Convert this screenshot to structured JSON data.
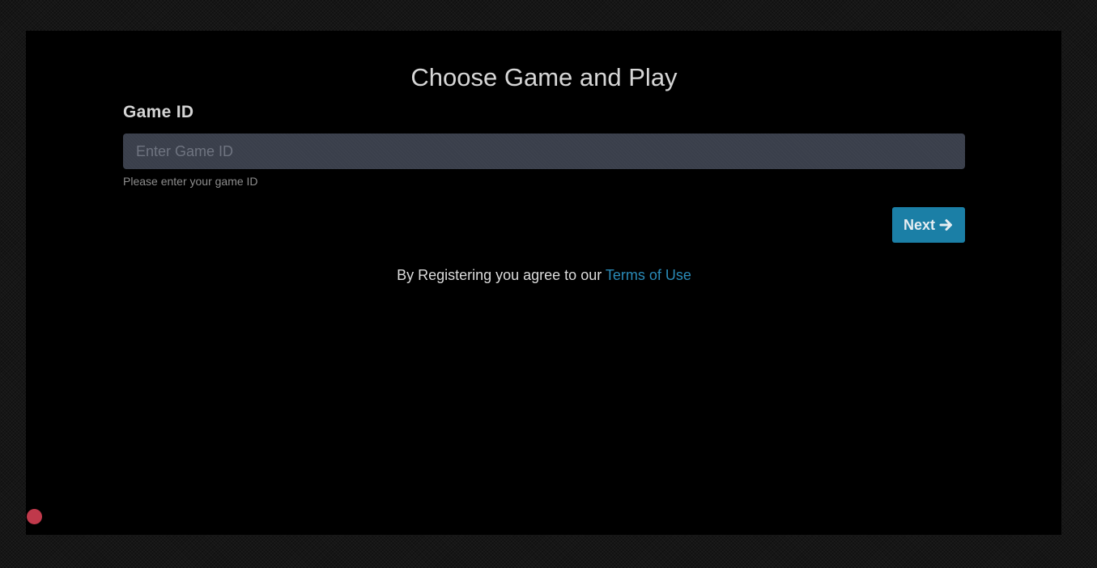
{
  "page": {
    "title": "Choose Game and Play"
  },
  "form": {
    "game_id_label": "Game ID",
    "game_id_value": "",
    "game_id_placeholder": "Enter Game ID",
    "help_text": "Please enter your game ID",
    "next_label": "Next",
    "next_icon": "arrow-right-icon"
  },
  "terms": {
    "prefix": "By Registering you agree to our",
    "link_label": "Terms of Use"
  },
  "colors": {
    "accent": "#1b7fa6",
    "link": "#2a8bb8",
    "status_dot": "#c0394b"
  }
}
